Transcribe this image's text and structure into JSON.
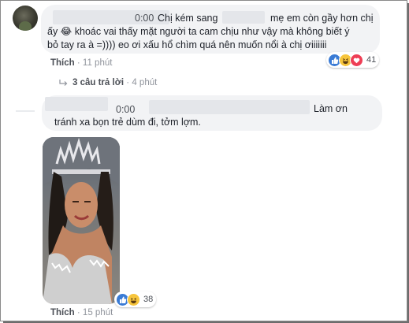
{
  "comment1": {
    "audio_time": "0:00",
    "text_line1_a": "Chị kém sang",
    "text_line1_b": "mẹ em còn gầy hơn chị",
    "text_line2": "ấy 😂 khoác vai thấy mặt người ta cam chịu như vậy mà không biết ý",
    "text_line3": "bỏ tay ra à =)))) eo ơi xấu hổ chìm quá nên muốn nổi à chị ơiiiiiii",
    "action_label": "Thích",
    "time": "11 phút",
    "reaction_count": "41",
    "replies_label": "3 câu trả lời",
    "replies_time": "4 phút",
    "reactions": [
      "like-icon",
      "haha-icon",
      "love-icon"
    ]
  },
  "comment2": {
    "audio_time": "0:00",
    "text_line1": "Làm ơn",
    "text_line2": "tránh xa bọn trẻ dùm đi, tởm lợm.",
    "action_label": "Thích",
    "time": "15 phút",
    "reaction_count": "38",
    "reactions": [
      "like-icon",
      "haha-icon"
    ]
  },
  "separator": "·",
  "colors": {
    "bubble": "#f2f3f5",
    "meta_text": "#90949c",
    "link_text": "#4b4f56",
    "like_blue": "#3a7bd5",
    "haha_yellow": "#f7c53c",
    "love_red": "#ee3e55"
  }
}
